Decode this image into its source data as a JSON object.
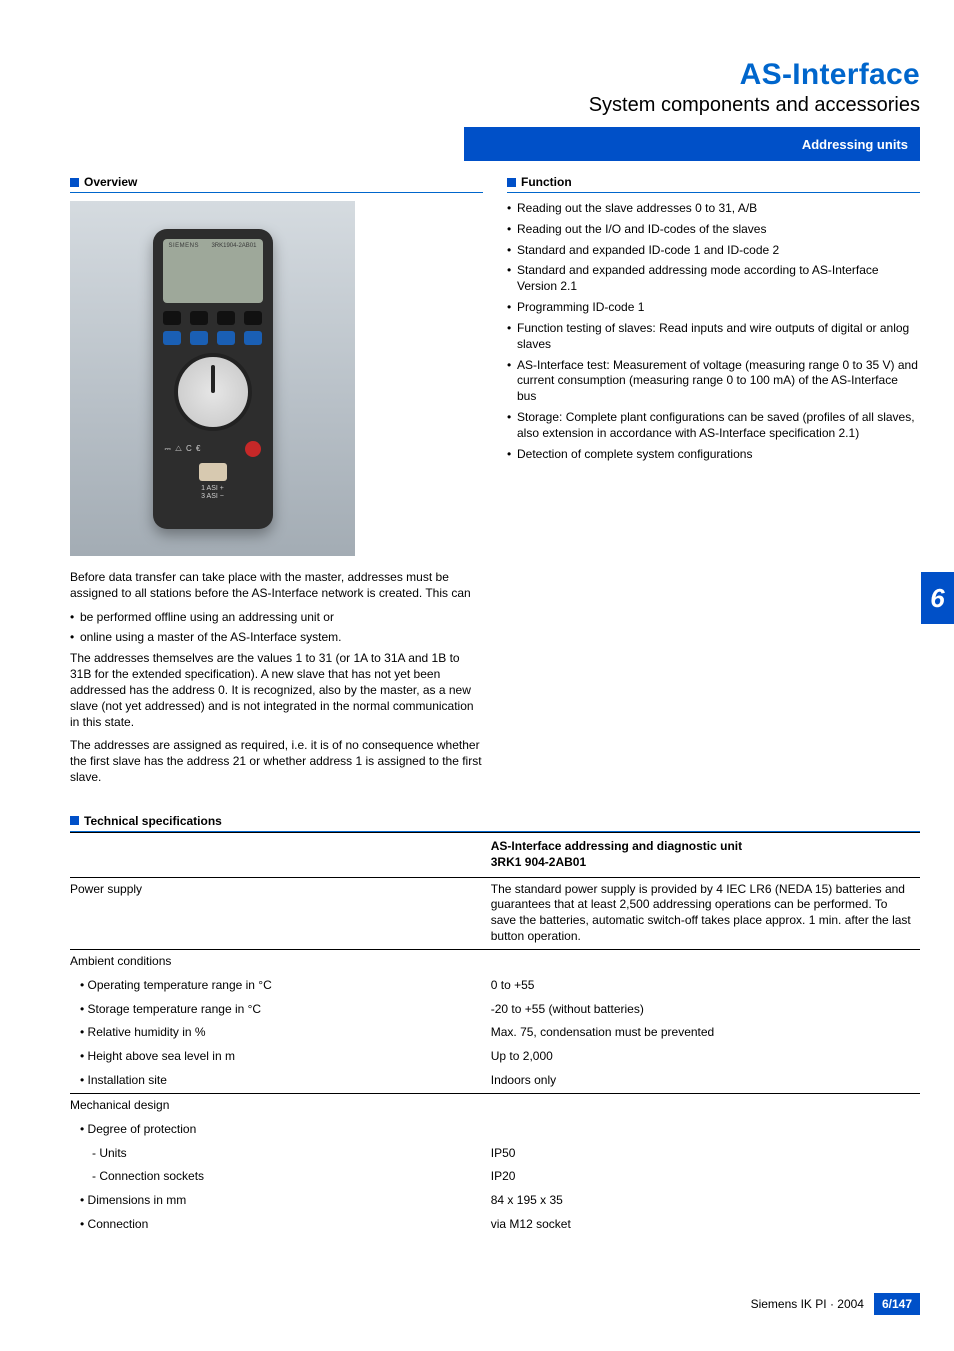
{
  "header": {
    "title": "AS-Interface",
    "subtitle": "System components and accessories",
    "band": "Addressing units"
  },
  "overview": {
    "heading": "Overview",
    "device": {
      "brand": "SIEMENS",
      "model": "3RK1904-2AB01",
      "asi1": "1 ASI +",
      "asi2": "3 ASI −",
      "icons": "⎓  △ C €"
    },
    "p1": "Before data transfer can take place with the master, addresses must be assigned to all stations before the AS-Interface network is created. This can",
    "bullets": [
      "be performed offline using an addressing unit or",
      "online using a master of the AS-Interface system."
    ],
    "p2": "The addresses themselves are the values 1 to 31 (or 1A to 31A and 1B to 31B for the extended specification). A new slave that has not yet been addressed has the address 0. It is recognized, also by the master, as a new slave (not yet addressed) and is not integrated in the normal communication in this state.",
    "p3": "The addresses are assigned as required, i.e. it is of no consequence whether the first slave has the address 21 or whether address 1 is assigned to the first slave."
  },
  "function": {
    "heading": "Function",
    "bullets": [
      "Reading out the slave addresses 0 to 31, A/B",
      "Reading out the I/O and ID-codes of the slaves",
      "Standard and expanded ID-code 1 and ID-code 2",
      "Standard and expanded addressing mode according to AS-Interface Version 2.1",
      "Programming ID-code 1",
      "Function testing of slaves: Read inputs and wire outputs of digital or anlog slaves",
      "AS-Interface test: Measurement of voltage (measuring range 0 to 35 V) and current consumption (measuring range 0 to 100 mA) of the AS-Interface bus",
      "Storage: Complete plant configurations can be saved (profiles of all slaves, also extension in accordance with AS-Interface specification 2.1)",
      "Detection of complete system configurations"
    ]
  },
  "tech": {
    "heading": "Technical specifications",
    "col_header_l1": "AS-Interface addressing and diagnostic unit",
    "col_header_l2": "3RK1 904-2AB01",
    "rows": {
      "power_supply_k": "Power supply",
      "power_supply_v": "The standard power supply is provided by 4 IEC LR6 (NEDA 15) batteries and guarantees that at least 2,500 addressing operations can be performed. To save the batteries, automatic switch-off takes place approx. 1 min. after the last button operation.",
      "ambient_k": "Ambient conditions",
      "op_temp_k": "• Operating temperature range in °C",
      "op_temp_v": "0 to +55",
      "st_temp_k": "• Storage temperature range in °C",
      "st_temp_v": "-20 to +55 (without batteries)",
      "rh_k": "• Relative humidity in %",
      "rh_v": "Max. 75, condensation must be prevented",
      "height_k": "• Height above sea level in m",
      "height_v": "Up to 2,000",
      "install_k": "• Installation site",
      "install_v": "Indoors only",
      "mech_k": "Mechanical design",
      "dop_k": "• Degree of protection",
      "units_k": "- Units",
      "units_v": "IP50",
      "conn_sock_k": "- Connection sockets",
      "conn_sock_v": "IP20",
      "dim_k": "• Dimensions in mm",
      "dim_v": "84 x 195 x 35",
      "conn_k": "• Connection",
      "conn_v": "via M12 socket"
    }
  },
  "sidetab": "6",
  "footer": {
    "text": "Siemens IK PI · 2004",
    "page": "6/147"
  }
}
